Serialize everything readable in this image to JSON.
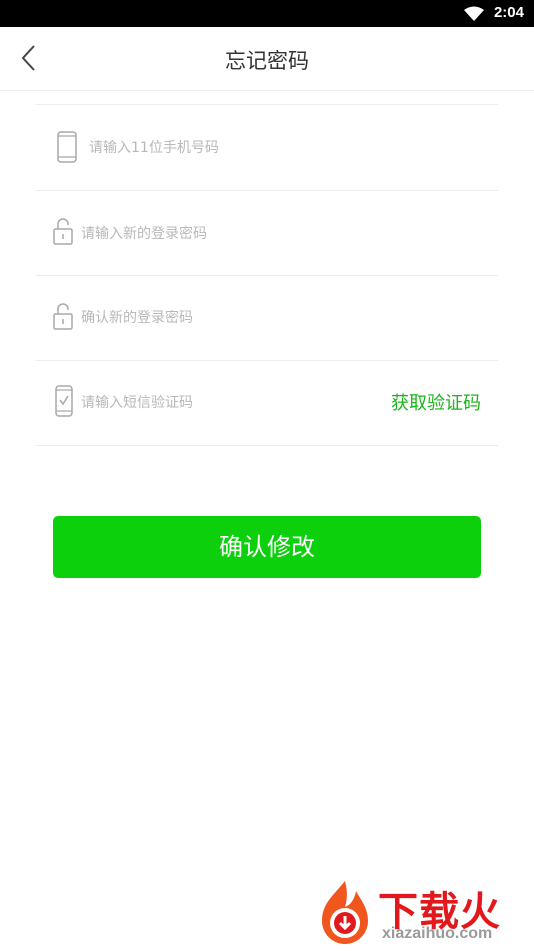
{
  "status_bar": {
    "time": "2:04"
  },
  "header": {
    "title": "忘记密码"
  },
  "form": {
    "phone_placeholder": "请输入11位手机号码",
    "new_password_placeholder": "请输入新的登录密码",
    "confirm_password_placeholder": "确认新的登录密码",
    "sms_code_placeholder": "请输入短信验证码",
    "get_code_label": "获取验证码"
  },
  "submit_label": "确认修改",
  "watermark": {
    "brand": "下载火",
    "url": "xiazaihuo.com"
  },
  "colors": {
    "accent": "#0bd00b",
    "link_green": "#1bb41b",
    "placeholder": "#b8b8b8",
    "watermark_red": "#e2181d"
  },
  "icons": [
    "wifi-icon",
    "back-arrow-icon",
    "phone-icon",
    "lock-icon",
    "sms-phone-icon",
    "logo-icon"
  ]
}
